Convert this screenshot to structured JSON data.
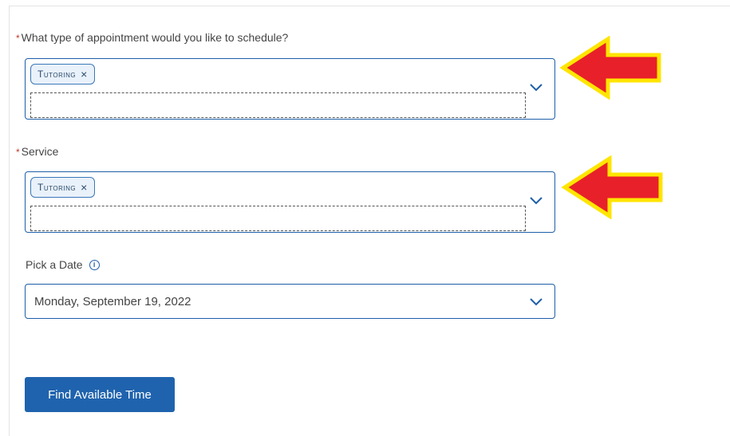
{
  "appointment_type": {
    "required_mark": "*",
    "label": "What type of appointment would you like to schedule?",
    "chip_label": "Tutoring",
    "chip_remove": "×"
  },
  "service": {
    "required_mark": "*",
    "label": "Service",
    "chip_label": "Tutoring",
    "chip_remove": "×"
  },
  "date": {
    "label": "Pick a Date",
    "info_icon": "i",
    "value": "Monday, September 19, 2022"
  },
  "actions": {
    "find_label": "Find Available Time"
  },
  "colors": {
    "accent": "#1f63ae",
    "arrow_fill": "#e8202a",
    "arrow_outline": "#ffe500"
  }
}
